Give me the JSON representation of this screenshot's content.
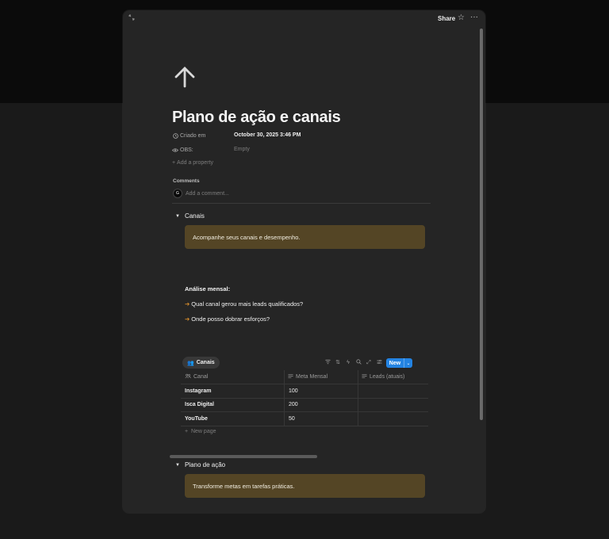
{
  "topbar": {
    "share_label": "Share",
    "star_icon": "star-icon",
    "more_icon": "more-icon"
  },
  "page": {
    "icon": "arrow-up-icon",
    "title": "Plano de ação e canais",
    "properties": [
      {
        "icon": "clock-icon",
        "name": "Criado em",
        "value": "October 30, 2025 3:46 PM"
      },
      {
        "icon": "eye-icon",
        "name": "OBS:",
        "value": "Empty"
      }
    ],
    "add_property": "Add a property",
    "comments_label": "Comments",
    "comment_placeholder": "Add a comment...",
    "avatar_initial": "G"
  },
  "section_canais": {
    "toggle_label": "Canais",
    "callout_text": "Acompanhe seus canais e desempenho.",
    "analysis_heading": "Análise mensal:",
    "questions": [
      "Qual canal gerou mais leads qualificados?",
      "Onde posso dobrar esforços?"
    ],
    "arrow_glyph": "➔"
  },
  "database": {
    "tab_label": "Canais",
    "new_label": "New",
    "columns": [
      "Canal",
      "Meta Mensal",
      "Leads (atuais)"
    ],
    "rows": [
      {
        "canal": "Instagram",
        "meta": "100",
        "leads": ""
      },
      {
        "canal": "Isca Digital",
        "meta": "200",
        "leads": ""
      },
      {
        "canal": "YouTube",
        "meta": "50",
        "leads": ""
      }
    ],
    "new_page": "New page"
  },
  "section_plano": {
    "toggle_label": "Plano de ação",
    "callout_text": "Transforme metas em tarefas práticas."
  },
  "colors": {
    "background": "#1a1a1a",
    "modal": "#252525",
    "callout": "#544525",
    "accent_blue": "#2383e2",
    "arrow_orange": "#d48b2c"
  }
}
